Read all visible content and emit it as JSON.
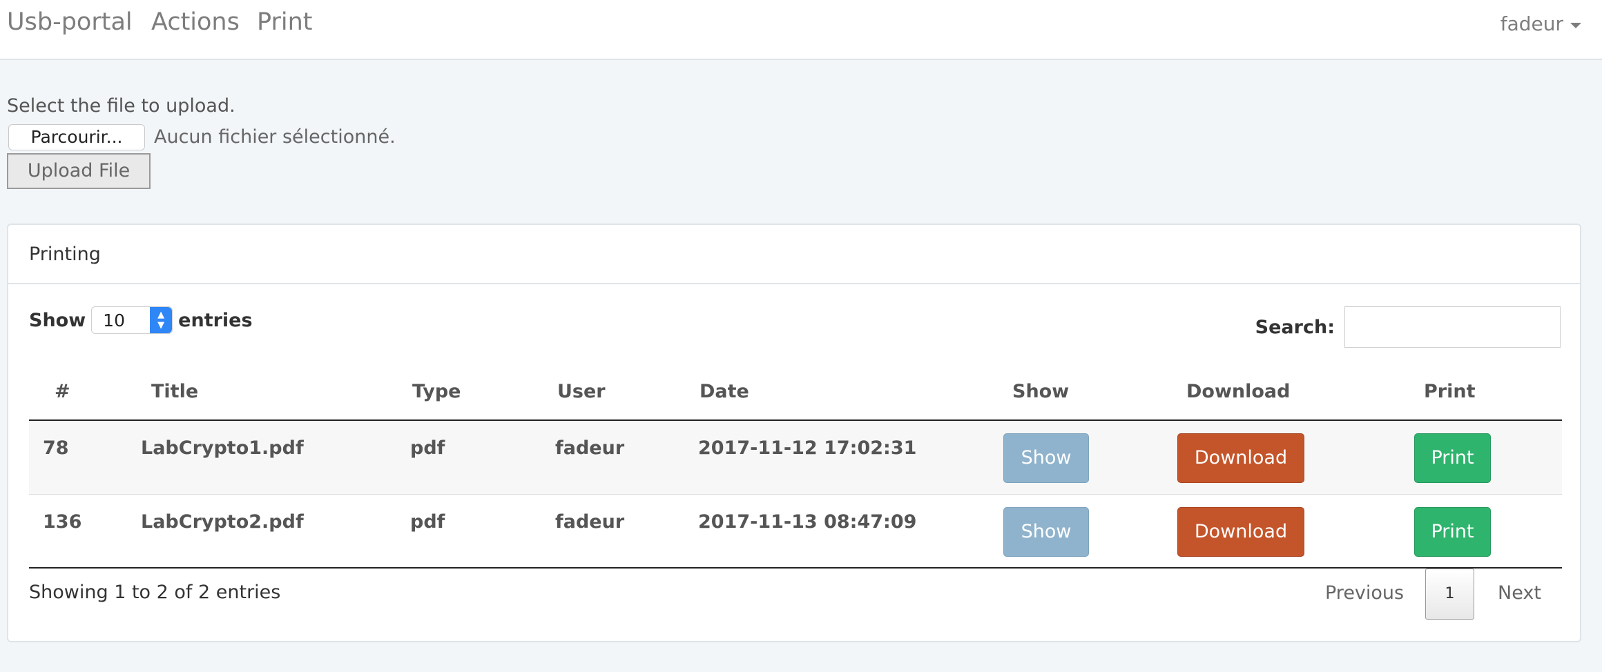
{
  "navbar": {
    "brand": "Usb-portal",
    "links": [
      "Actions",
      "Print"
    ],
    "user": "fadeur"
  },
  "upload": {
    "label": "Select the file to upload.",
    "file_button": "Parcourir...",
    "file_status": "Aucun fichier sélectionné.",
    "submit": "Upload File"
  },
  "panel": {
    "title": "Printing",
    "length": {
      "prefix": "Show",
      "value": "10",
      "suffix": "entries"
    },
    "search": {
      "label": "Search:",
      "value": ""
    },
    "columns": [
      "#",
      "Title",
      "Type",
      "User",
      "Date",
      "Show",
      "Download",
      "Print"
    ],
    "rows": [
      {
        "id": "78",
        "title": "LabCrypto1.pdf",
        "type": "pdf",
        "user": "fadeur",
        "date": "2017-11-12 17:02:31",
        "show": "Show",
        "download": "Download",
        "print": "Print"
      },
      {
        "id": "136",
        "title": "LabCrypto2.pdf",
        "type": "pdf",
        "user": "fadeur",
        "date": "2017-11-13 08:47:09",
        "show": "Show",
        "download": "Download",
        "print": "Print"
      }
    ],
    "info": "Showing 1 to 2 of 2 entries",
    "pagination": {
      "previous": "Previous",
      "page": "1",
      "next": "Next"
    }
  },
  "colors": {
    "show_button": "#8fb3cc",
    "download_button": "#c4552a",
    "print_button": "#2fb46e",
    "page_background": "#f2f6f9"
  },
  "icons": {
    "user_menu": "caret-down-icon",
    "select_spinner": "up-down-arrows-icon"
  }
}
